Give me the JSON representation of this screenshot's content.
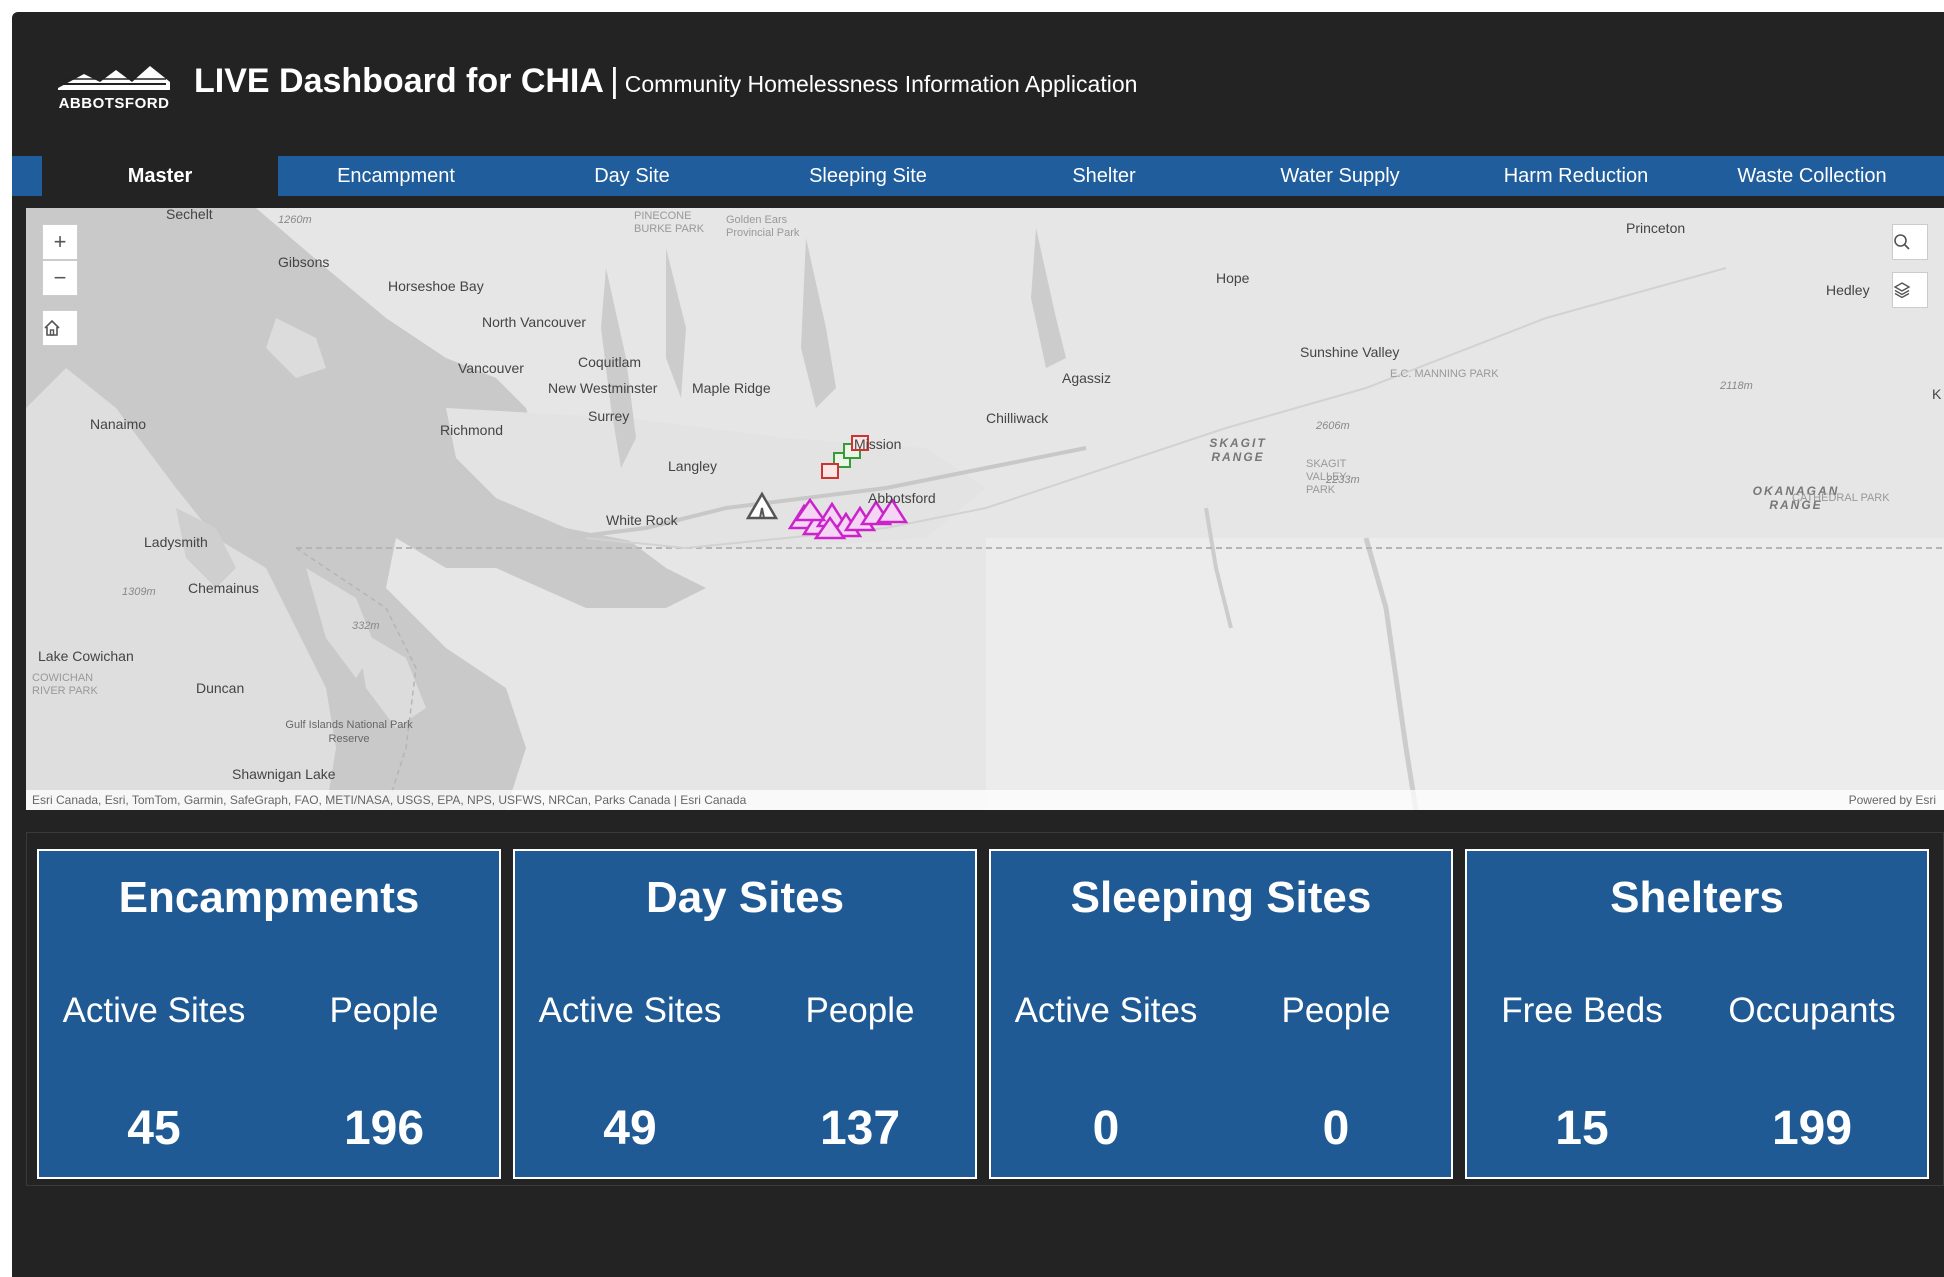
{
  "header": {
    "logo_text": "ABBOTSFORD",
    "title": "LIVE Dashboard for CHIA",
    "separator": "|",
    "subtitle": "Community Homelessness Information Application"
  },
  "nav": {
    "tabs": [
      {
        "label": "Master",
        "active": true
      },
      {
        "label": "Encampment"
      },
      {
        "label": "Day Site"
      },
      {
        "label": "Sleeping Site"
      },
      {
        "label": "Shelter"
      },
      {
        "label": "Water Supply"
      },
      {
        "label": "Harm Reduction"
      },
      {
        "label": "Waste Collection"
      }
    ]
  },
  "map": {
    "controls": {
      "zoom_in": "+",
      "zoom_out": "−",
      "home_icon": "home-icon",
      "search_icon": "search-icon",
      "layers_icon": "layers-icon"
    },
    "places": {
      "sechelt": "Sechelt",
      "gibsons": "Gibsons",
      "horseshoe_bay": "Horseshoe Bay",
      "north_vancouver": "North Vancouver",
      "vancouver": "Vancouver",
      "coquitlam": "Coquitlam",
      "new_westminster": "New Westminster",
      "maple_ridge": "Maple Ridge",
      "richmond": "Richmond",
      "surrey": "Surrey",
      "langley": "Langley",
      "white_rock": "White Rock",
      "nanaimo": "Nanaimo",
      "ladysmith": "Ladysmith",
      "chemainus": "Chemainus",
      "lake_cowichan": "Lake Cowichan",
      "cowichan_park": "COWICHAN RIVER PARK",
      "duncan": "Duncan",
      "gulf_islands": "Gulf Islands National Park Reserve",
      "shawnigan_lake": "Shawnigan Lake",
      "hope": "Hope",
      "agassiz": "Agassiz",
      "chilliwack": "Chilliwack",
      "mission": "Mission",
      "abbotsford": "Abbotsford",
      "princeton": "Princeton",
      "hedley": "Hedley",
      "sunshine_valley": "Sunshine Valley",
      "manning_park": "E.C. MANNING PARK",
      "skagit_range": "SKAGIT RANGE",
      "skagit_park": "SKAGIT VALLEY PARK",
      "okanagan_range": "OKANAGAN RANGE",
      "cathedral_park": "CATHEDRAL PARK",
      "pinecone_park": "PINECONE BURKE PARK",
      "golden_ears": "Golden Ears Provincial Park",
      "elev_1260": "1260m",
      "elev_2606": "2606m",
      "elev_2118": "2118m",
      "elev_2233": "2233m",
      "elev_1309": "1309m",
      "elev_332": "332m",
      "edge_k": "K"
    },
    "attribution": "Esri Canada, Esri, TomTom, Garmin, SafeGraph, FAO, METI/NASA, USGS, EPA, NPS, USFWS, NRCan, Parks Canada | Esri Canada",
    "powered_by": "Powered by Esri",
    "colors": {
      "encampment": "#cc22cc",
      "day_site": "#3a9a3a",
      "sleeping_site": "#cc3333",
      "shelter": "#555555"
    }
  },
  "stats": [
    {
      "title": "Encampments",
      "labels": [
        "Active Sites",
        "People"
      ],
      "values": [
        "45",
        "196"
      ]
    },
    {
      "title": "Day Sites",
      "labels": [
        "Active Sites",
        "People"
      ],
      "values": [
        "49",
        "137"
      ]
    },
    {
      "title": "Sleeping Sites",
      "labels": [
        "Active Sites",
        "People"
      ],
      "values": [
        "0",
        "0"
      ]
    },
    {
      "title": "Shelters",
      "labels": [
        "Free Beds",
        "Occupants"
      ],
      "values": [
        "15",
        "199"
      ]
    }
  ]
}
